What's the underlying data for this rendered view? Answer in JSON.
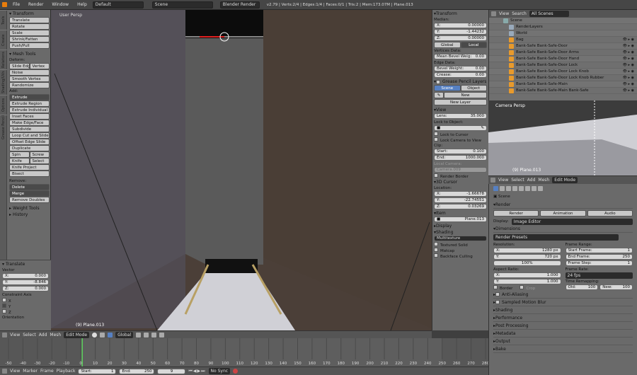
{
  "topbar": {
    "menus": [
      "File",
      "Render",
      "Window",
      "Help"
    ],
    "layout": "Default",
    "scene": "Scene",
    "engine": "Blender Render",
    "stats": "v2.79 | Verts:2/4 | Edges:1/4 | Faces:0/1 | Tris:2 | Mem:173.07M | Plane.013"
  },
  "tool_tabs": [
    "Tools",
    "Create",
    "Relations",
    "Shading/UVs",
    "Options",
    "Grease Pencil"
  ],
  "toolshelf": {
    "transform_header": "Transform",
    "transform": [
      "Translate",
      "Rotate",
      "Scale",
      "Shrink/Fatten",
      "Push/Pull"
    ],
    "meshtools_header": "Mesh Tools",
    "deform_label": "Deform:",
    "deform_row": [
      "Slide Edge",
      "Vertex"
    ],
    "deform": [
      "Noise",
      "Smooth Vertex",
      "Randomize"
    ],
    "add_label": "Add:",
    "add": [
      "Extrude",
      "Extrude Region",
      "Extrude Individual",
      "Inset Faces",
      "Make Edge/Face",
      "Subdivide",
      "Loop Cut and Slide",
      "Offset Edge Slide",
      "Duplicate"
    ],
    "spin_row": [
      "Spin",
      "Screw"
    ],
    "knife_row": [
      "Knife",
      "Select"
    ],
    "more": [
      "Knife Project",
      "Bisect"
    ],
    "remove_label": "Remove:",
    "remove_dd": [
      "Delete",
      "Merge"
    ],
    "remove_doubles": "Remove Doubles",
    "weight_tools": "Weight Tools",
    "history": "History"
  },
  "operator": {
    "header": "Translate",
    "vector_label": "Vector",
    "vector": [
      {
        "axis": "X:",
        "val": "0.000"
      },
      {
        "axis": "Y:",
        "val": "-8.846"
      },
      {
        "axis": "Z:",
        "val": "0.000"
      }
    ],
    "constraint_label": "Constraint Axis",
    "constraints": [
      "X",
      "Y",
      "Z"
    ],
    "orientation": "Orientation"
  },
  "viewport": {
    "label": "User Persp",
    "object": "(9) Plane.013"
  },
  "npanel": {
    "transform": "Transform",
    "median": "Median:",
    "median_vals": [
      {
        "a": "X:",
        "v": "0.00000"
      },
      {
        "a": "Y:",
        "v": "-1.44232"
      },
      {
        "a": "Z:",
        "v": "0.00000"
      }
    ],
    "gl_tabs": [
      "Global",
      "Local"
    ],
    "vdata": "Vertices Data:",
    "mean_bevel": {
      "a": "Mean Bevel Weig:",
      "v": "0.00"
    },
    "edata": "Edge Data:",
    "bevel_weight": {
      "a": "Bevel Weight:",
      "v": "0.00"
    },
    "crease": {
      "a": "Crease:",
      "v": "0.00"
    },
    "grease": "Grease Pencil Layers",
    "so_tabs": [
      "Scene",
      "Object"
    ],
    "new_btn": "New",
    "new_layer": "New Layer",
    "view": "View",
    "lens": {
      "a": "Lens:",
      "v": "35.000"
    },
    "lock_obj": "Lock to Object:",
    "lock_cursor": "Lock to Cursor",
    "lock_camera": "Lock Camera to View",
    "clip": "Clip:",
    "clip_start": {
      "a": "Start:",
      "v": "0.100"
    },
    "clip_end": {
      "a": "End:",
      "v": "1000.000"
    },
    "local_camera": "Local Camera:",
    "camera_name": "Camera.009",
    "render_border": "Render Border",
    "cursor3d": "3D Cursor",
    "location": "Location:",
    "cursor_vals": [
      {
        "a": "X:",
        "v": "-1.66678"
      },
      {
        "a": "Y:",
        "v": "-22.74551"
      },
      {
        "a": "Z:",
        "v": "0.03269"
      }
    ],
    "item": "Item",
    "item_name": "Plane.013",
    "display": "Display",
    "shading": "Shading",
    "shading_mode": "Multitexture",
    "tex_solid": "Textured Solid",
    "matcap": "Matcap",
    "backface": "Backface Culling"
  },
  "outliner": {
    "menus": [
      "View",
      "Search"
    ],
    "scope": "All Scenes",
    "rows": [
      "Scene",
      "RenderLayers",
      "World",
      "Bag",
      "Bank-Safe Bank-Safe-Door",
      "Bank-Safe Bank-Safe-Door Arms",
      "Bank-Safe Bank-Safe-Door Hand",
      "Bank-Safe Bank-Safe-Door Lock",
      "Bank-Safe Bank-Safe-Door Lock Knob",
      "Bank-Safe Bank-Safe-Door Lock Knob Rubber",
      "Bank-Safe Bank-Safe-Main",
      "Bank-Safe Bank-Safe-Main Bank-Safe"
    ]
  },
  "camview": {
    "label": "Camera Persp",
    "object": "(9) Plane.013"
  },
  "camheader": {
    "menus": [
      "View",
      "Select",
      "Add",
      "Mesh"
    ],
    "mode": "Edit Mode"
  },
  "props": {
    "crumb": "Scene",
    "render": "Render",
    "render_btns": [
      "Render",
      "Animation",
      "Audio"
    ],
    "display_label": "Display:",
    "display_val": "Image Editor",
    "dimensions": "Dimensions",
    "presets": "Render Presets",
    "resolution": "Resolution:",
    "res_x": {
      "a": "X:",
      "v": "1280 px"
    },
    "res_y": {
      "a": "Y:",
      "v": "720 px"
    },
    "res_pct": "100%",
    "frame_range": "Frame Range:",
    "start_frame": {
      "a": "Start Frame:",
      "v": "1"
    },
    "end_frame": {
      "a": "End Frame:",
      "v": "250"
    },
    "frame_step": {
      "a": "Frame Step:",
      "v": "1"
    },
    "aspect": "Aspect Ratio:",
    "asp_x": {
      "a": "X:",
      "v": "1.000"
    },
    "asp_y": {
      "a": "Y:",
      "v": "1.000"
    },
    "frame_rate": "Frame Rate:",
    "fps": "24 fps",
    "time_remap": "Time Remapping:",
    "old": {
      "a": "Old:",
      "v": "100"
    },
    "new": {
      "a": "New:",
      "v": "100"
    },
    "border": "Border",
    "crop": "Crop",
    "sections": [
      "Anti-Aliasing",
      "Sampled Motion Blur",
      "Shading",
      "Performance",
      "Post Processing",
      "Metadata",
      "Output",
      "Bake"
    ]
  },
  "vp_header": {
    "menus": [
      "View",
      "Select",
      "Add",
      "Mesh"
    ],
    "mode": "Edit Mode",
    "orient": "Global"
  },
  "timeline": {
    "ticks": [
      "-50",
      "-40",
      "-30",
      "-20",
      "-10",
      "0",
      "10",
      "20",
      "30",
      "40",
      "50",
      "60",
      "70",
      "80",
      "90",
      "100",
      "110",
      "120",
      "130",
      "140",
      "150",
      "160",
      "170",
      "180",
      "190",
      "200",
      "210",
      "220",
      "230",
      "240",
      "250",
      "260",
      "270",
      "280"
    ],
    "current_frame": 1
  },
  "tl_header": {
    "menus": [
      "View",
      "Marker",
      "Frame",
      "Playback"
    ],
    "start": {
      "a": "Start:",
      "v": "1"
    },
    "end": {
      "a": "End:",
      "v": "250"
    },
    "frame": "9",
    "sync": "No Sync"
  }
}
